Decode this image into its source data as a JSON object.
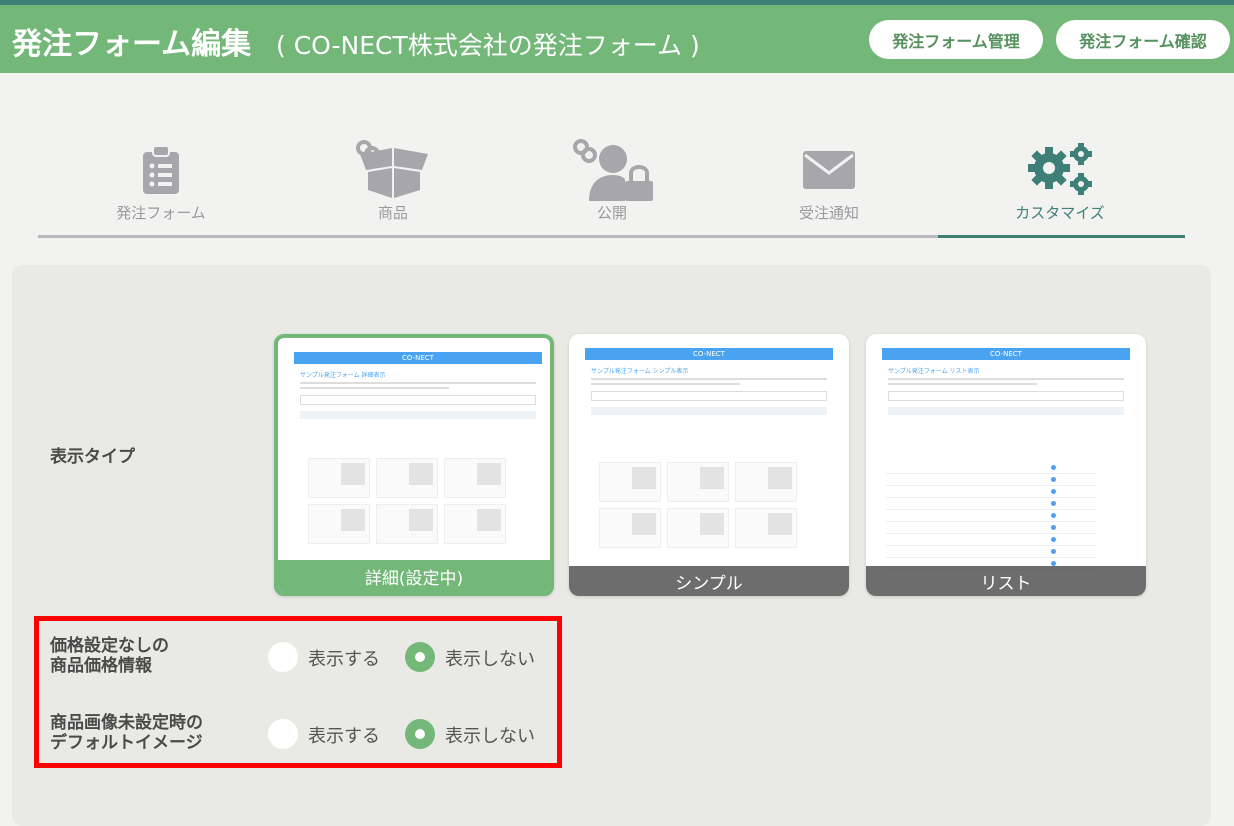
{
  "header": {
    "title": "発注フォーム編集",
    "subtitle": "( CO-NECT株式会社の発注フォーム )",
    "buttons": {
      "manage": "発注フォーム管理",
      "confirm": "発注フォーム確認"
    }
  },
  "steps": [
    {
      "label": "発注フォーム",
      "icon": "clipboard-list-icon",
      "active": false
    },
    {
      "label": "商品",
      "icon": "linked-box-icon",
      "active": false
    },
    {
      "label": "公開",
      "icon": "linked-user-lock-icon",
      "active": false
    },
    {
      "label": "受注通知",
      "icon": "envelope-icon",
      "active": false
    },
    {
      "label": "カスタマイズ",
      "icon": "gears-icon",
      "active": true
    }
  ],
  "display_type": {
    "label": "表示タイプ",
    "cards": [
      {
        "caption": "詳細(設定中)",
        "preview_brand": "CO-NECT",
        "preview_title": "サンプル発注フォーム 詳細表示",
        "selected": true
      },
      {
        "caption": "シンプル",
        "preview_brand": "CO-NECT",
        "preview_title": "サンプル発注フォーム シンプル表示",
        "selected": false
      },
      {
        "caption": "リスト",
        "preview_brand": "CO-NECT",
        "preview_title": "サンプル発注フォーム リスト表示",
        "selected": false
      }
    ]
  },
  "options": [
    {
      "label_line1": "価格設定なしの",
      "label_line2": "商品価格情報",
      "show": "表示する",
      "hide": "表示しない",
      "selected": "hide"
    },
    {
      "label_line1": "商品画像未設定時の",
      "label_line2": "デフォルトイメージ",
      "show": "表示する",
      "hide": "表示しない",
      "selected": "hide"
    }
  ],
  "colors": {
    "header_green": "#73b779",
    "accent_teal": "#3e7f78",
    "highlight_red": "#ff0000",
    "preview_blue": "#4aa3f0"
  }
}
